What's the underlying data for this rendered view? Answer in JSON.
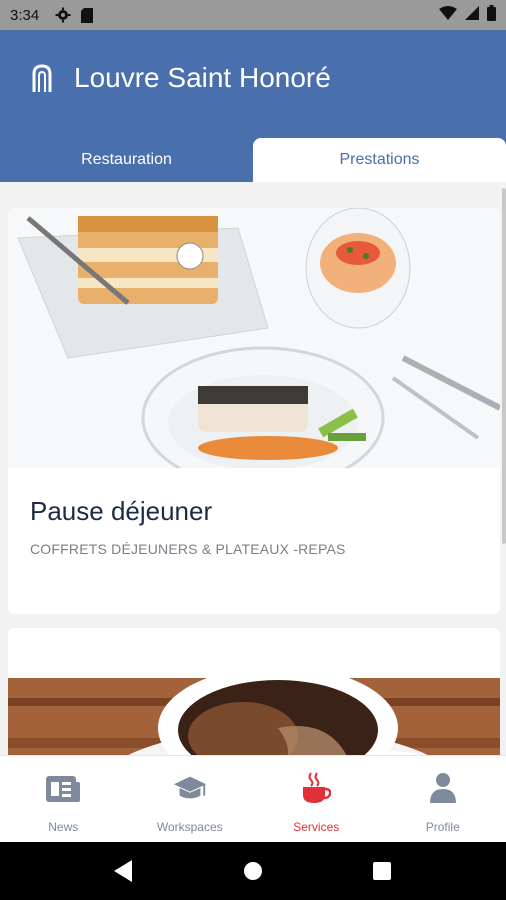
{
  "status_bar": {
    "time": "3:34",
    "icons_left": [
      "gear-icon",
      "sim-card-icon"
    ],
    "icons_right": [
      "wifi-icon",
      "signal-icon",
      "battery-icon"
    ]
  },
  "header": {
    "title": "Louvre Saint Honoré",
    "logo_icon": "arch-logo-icon"
  },
  "tabs": [
    {
      "label": "Restauration",
      "active": false
    },
    {
      "label": "Prestations",
      "active": true
    }
  ],
  "cards": [
    {
      "title": "Pause déjeuner",
      "subtitle": "COFFRETS DÉJEUNERS & PLATEAUX -REPAS",
      "image": "food-photo"
    },
    {
      "title": "",
      "subtitle": "",
      "image": "coffee-photo"
    }
  ],
  "bottom_nav": {
    "items": [
      {
        "label": "News",
        "icon": "newspaper-icon",
        "active": false
      },
      {
        "label": "Workspaces",
        "icon": "graduation-cap-icon",
        "active": false
      },
      {
        "label": "Services",
        "icon": "coffee-cup-icon",
        "active": true
      },
      {
        "label": "Profile",
        "icon": "person-icon",
        "active": false
      }
    ]
  },
  "colors": {
    "brand": "#4a6fad",
    "active": "#e0303a",
    "inactive": "#7e8a9c"
  }
}
